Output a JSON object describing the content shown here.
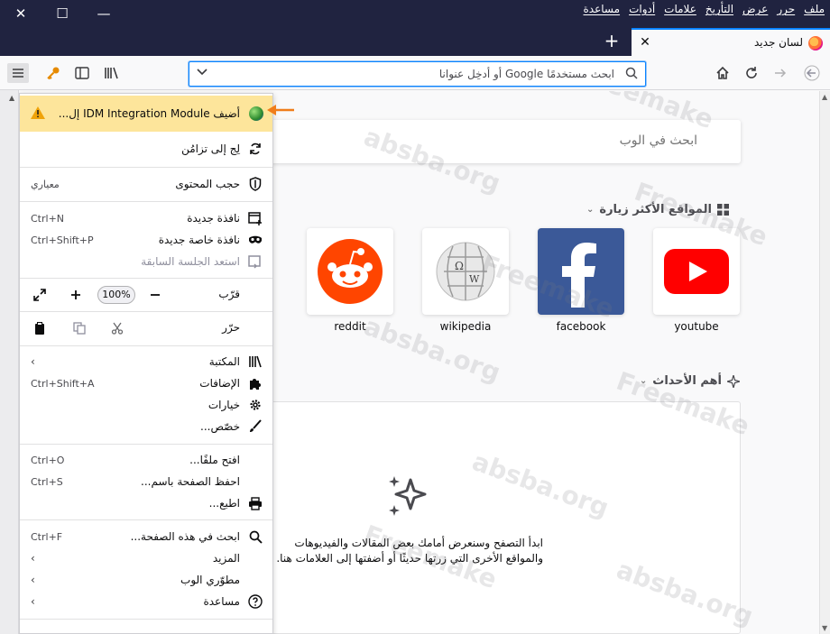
{
  "window": {
    "menu": [
      "ملف",
      "حرر",
      "عرض",
      "التأريخ",
      "علامات",
      "أدوات",
      "مساعدة"
    ],
    "controls": {
      "close": "✕",
      "maximize": "☐",
      "minimize": "—"
    }
  },
  "tab": {
    "title": "لسان جديد",
    "close": "✕",
    "new_tab": "+"
  },
  "urlbar": {
    "placeholder": "ابحث مستخدمًا Google أو أدخِل عنوانا"
  },
  "newtab": {
    "search_placeholder": "ابحث في الوب",
    "top_sites_title": "المواقع الأكثر زيارة",
    "sites": [
      {
        "label": "youtube",
        "color": "#ff0000"
      },
      {
        "label": "facebook",
        "color": "#3b5998"
      },
      {
        "label": "wikipedia",
        "color": "#e0e0e0"
      },
      {
        "label": "reddit",
        "color": "#ff4500"
      }
    ],
    "highlights_title": "أهم الأحداث",
    "highlights_line1": "ابدأ التصفح وسنعرض أمامك بعض المقالات والفيديوهات",
    "highlights_line2": "والمواقع الأخرى التي زرتها حديثًا أو أضفتها إلى العلامات هنا."
  },
  "menu": {
    "notification": "أضيف IDM Integration Module إل...",
    "sync": "لِج إلى تزامُن",
    "content_blocking": "حجب المحتوى",
    "content_blocking_value": "معياري",
    "new_window": "نافذة جديدة",
    "new_window_shortcut": "Ctrl+N",
    "private_window": "نافذة خاصة جديدة",
    "private_window_shortcut": "Ctrl+Shift+P",
    "restore_session": "استعد الجلسة السابقة",
    "zoom_label": "قرّب",
    "zoom_value": "100%",
    "edit_label": "حرّر",
    "library": "المكتبة",
    "addons": "الإضافات",
    "addons_shortcut": "Ctrl+Shift+A",
    "options": "خيارات",
    "customize": "خصّص...",
    "open_file": "افتح ملفًا...",
    "open_file_shortcut": "Ctrl+O",
    "save_page": "احفظ الصفحة باسم...",
    "save_page_shortcut": "Ctrl+S",
    "print": "اطبع...",
    "find": "ابحث في هذه الصفحة...",
    "find_shortcut": "Ctrl+F",
    "more": "المزيد",
    "web_developer": "مطوّري الوب",
    "help": "مساعدة"
  },
  "watermark": {
    "text1": "Freemake",
    "text2": "absba.org"
  }
}
